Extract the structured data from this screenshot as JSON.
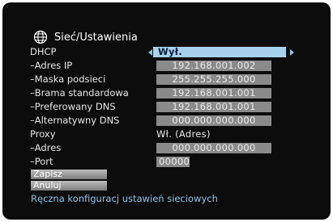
{
  "header": {
    "title": "Sieć/Ustawienia",
    "icon": "globe-icon"
  },
  "settings": [
    {
      "label": "DHCP",
      "value": "Wył."
    },
    {
      "label": "–Adres IP",
      "value": "192.168.001.002"
    },
    {
      "label": "–Maska podsieci",
      "value": "255.255.255.000"
    },
    {
      "label": "–Brama standardowa",
      "value": "192.168.001.001"
    },
    {
      "label": "–Preferowany DNS",
      "value": "192.168.001.001"
    },
    {
      "label": "–Alternatywny DNS",
      "value": "000.000.000.000"
    },
    {
      "label": "Proxy",
      "value": "Wł. (Adres)"
    },
    {
      "label": "–Adres",
      "value": "000.000.000.000"
    },
    {
      "label": "–Port",
      "value": "00000"
    }
  ],
  "buttons": {
    "save": "Zapisz",
    "cancel": "Anuluj"
  },
  "footer": {
    "hint": "Ręczna konfiguracj ustawień sieciowych"
  },
  "colors": {
    "highlight": "#a8d1ee",
    "hint_text": "#8fc3e8",
    "field": "#8a8a8a"
  }
}
